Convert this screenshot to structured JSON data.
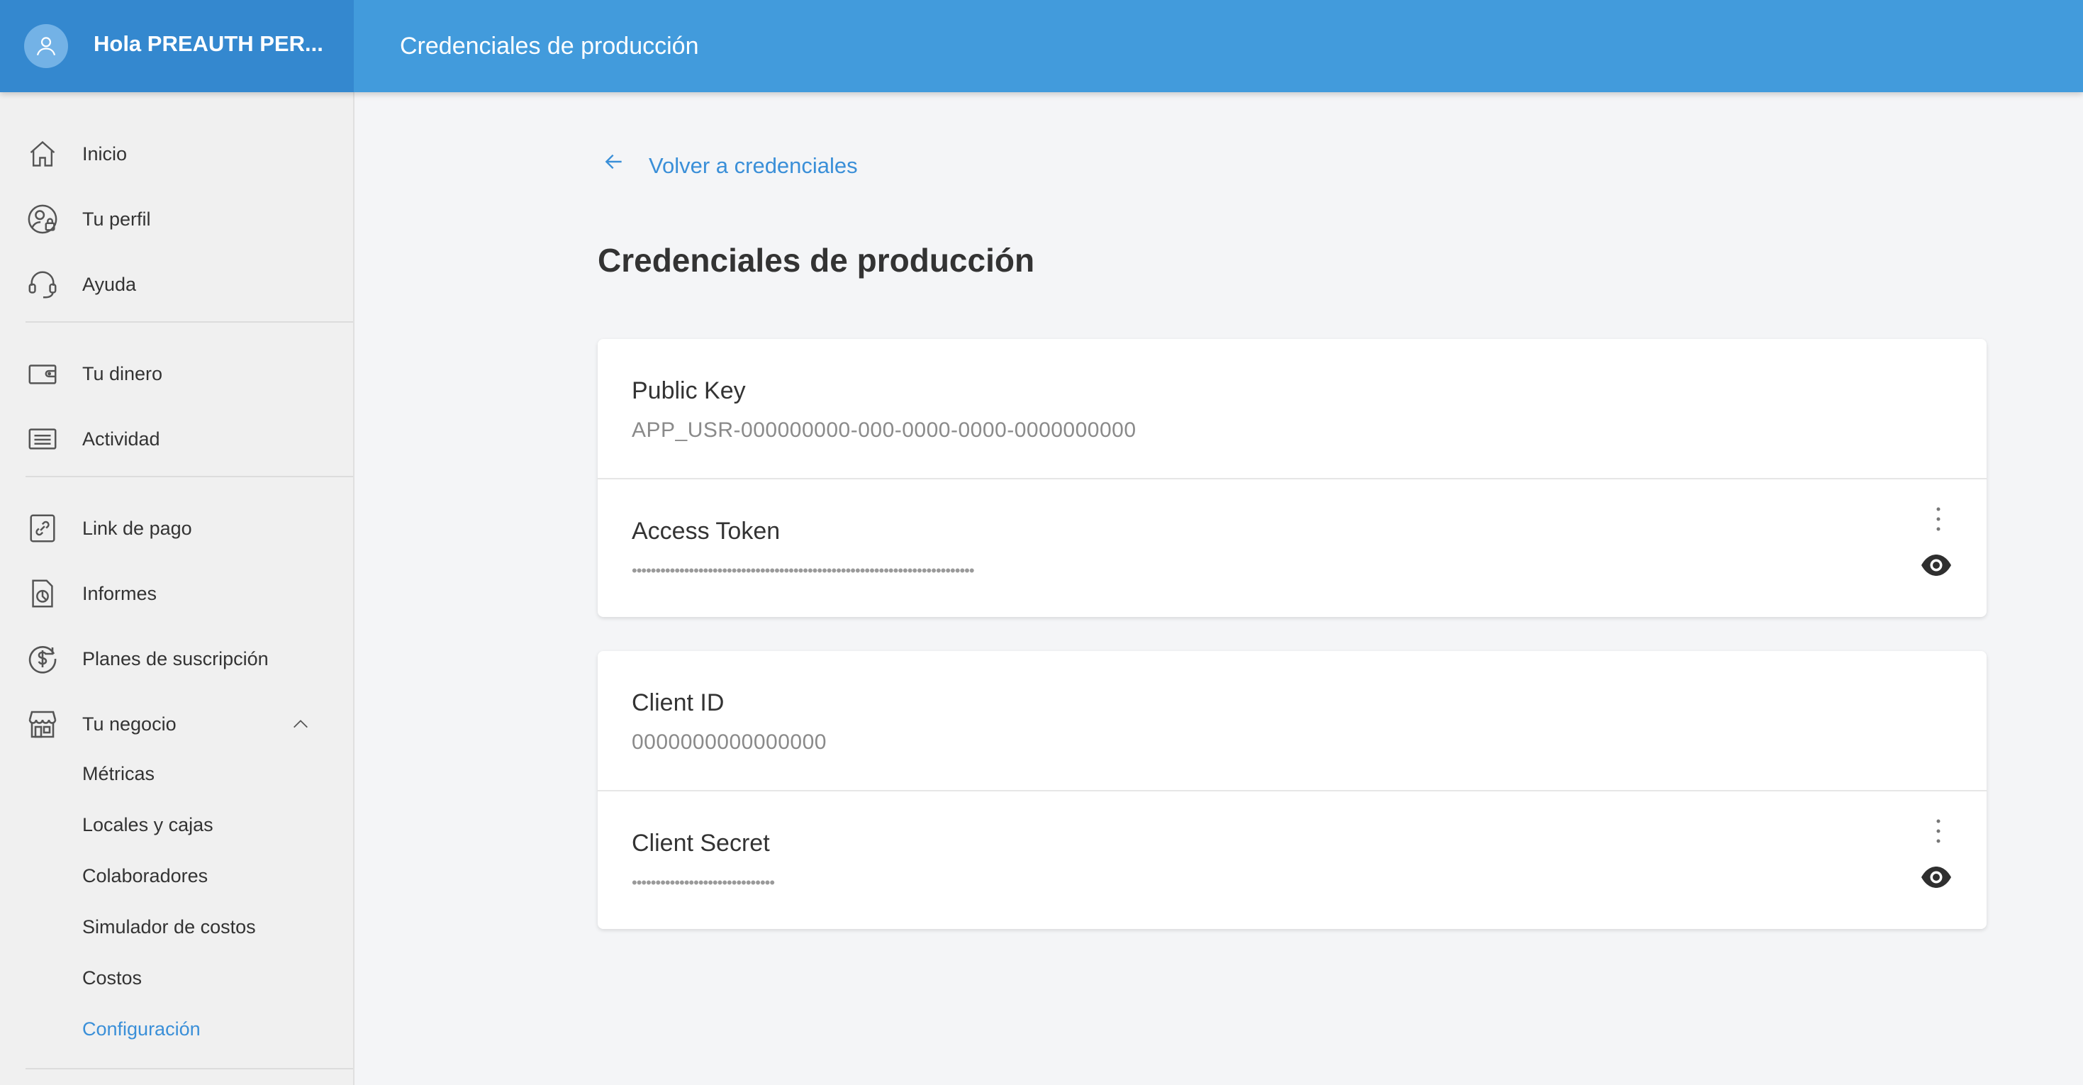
{
  "header": {
    "greeting": "Hola PREAUTH PER...",
    "title": "Credenciales de producción"
  },
  "sidebar": {
    "items": [
      {
        "label": "Inicio",
        "icon": "home-icon"
      },
      {
        "label": "Tu perfil",
        "icon": "profile-lock-icon"
      },
      {
        "label": "Ayuda",
        "icon": "headset-icon"
      },
      {
        "label": "Tu dinero",
        "icon": "wallet-icon"
      },
      {
        "label": "Actividad",
        "icon": "list-icon"
      },
      {
        "label": "Link de pago",
        "icon": "link-icon"
      },
      {
        "label": "Informes",
        "icon": "report-icon"
      },
      {
        "label": "Planes de suscripción",
        "icon": "dollar-circle-icon"
      },
      {
        "label": "Tu negocio",
        "icon": "store-icon"
      }
    ],
    "subitems": [
      {
        "label": "Métricas"
      },
      {
        "label": "Locales y cajas"
      },
      {
        "label": "Colaboradores"
      },
      {
        "label": "Simulador de costos"
      },
      {
        "label": "Costos"
      },
      {
        "label": "Configuración",
        "active": true
      }
    ]
  },
  "main": {
    "back_label": "Volver a credenciales",
    "title": "Credenciales de producción",
    "cards": [
      {
        "fields": [
          {
            "label": "Public Key",
            "value": "APP_USR-000000000-000-0000-0000-0000000000"
          },
          {
            "label": "Access Token",
            "value": "••••••••••••••••••••••••••••••••••••••••••••••••••••••••••••••••••••••••",
            "masked": true
          }
        ]
      },
      {
        "fields": [
          {
            "label": "Client ID",
            "value": "0000000000000000"
          },
          {
            "label": "Client Secret",
            "value": "••••••••••••••••••••••••••••••",
            "masked": true
          }
        ]
      }
    ]
  },
  "colors": {
    "topbar": "#429bdc",
    "topbar_left": "#3488cf",
    "accent": "#3a8fd8",
    "background": "#f4f5f7"
  }
}
